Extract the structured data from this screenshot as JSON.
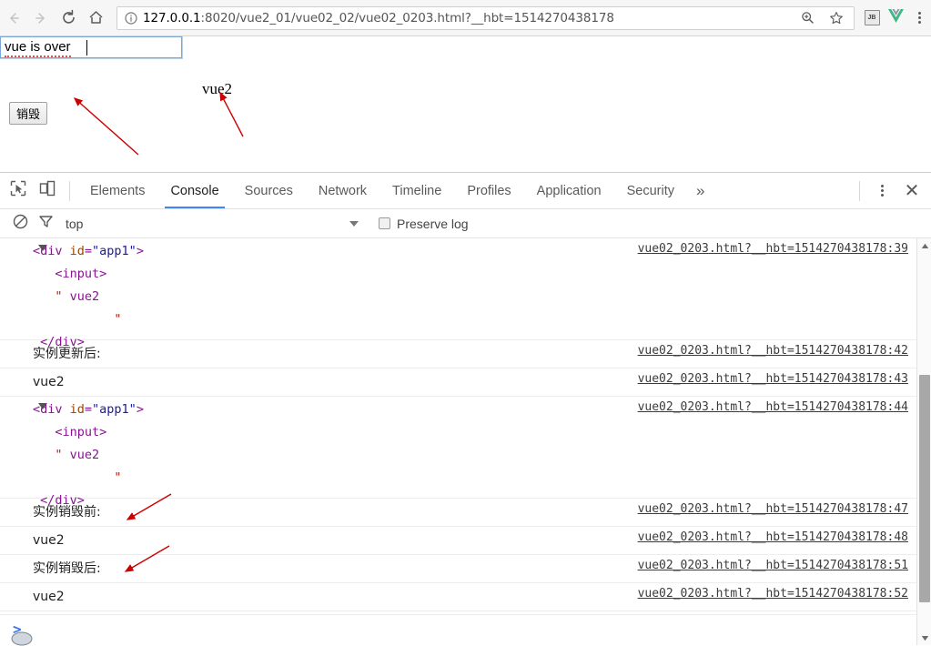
{
  "browser": {
    "nav": {
      "back_icon": "arrow-left-icon",
      "forward_icon": "arrow-right-icon",
      "reload_icon": "reload-icon",
      "home_icon": "home-icon"
    },
    "omnibox": {
      "info_icon": "page-info-icon",
      "url_host": "127.0.0.1",
      "url_rest": ":8020/vue2_01/vue02_02/vue02_0203.html?__hbt=1514270438178",
      "full_url": "127.0.0.1:8020/vue2_01/vue02_02/vue02_0203.html?__hbt=1514270438178",
      "zoom_icon": "zoom-magnifier-icon",
      "bookmark_icon": "star-icon"
    },
    "toolbar_right": {
      "extension_jb_label": "JB",
      "extension_jb_icon": "jetbrains-extension-icon",
      "extension_vue_icon": "vue-devtools-icon",
      "menu_icon": "kebab-menu-icon"
    }
  },
  "page": {
    "input": {
      "value": "vue is over",
      "placeholder": ""
    },
    "destroy_button_label": "销毁",
    "output_text": "vue2"
  },
  "devtools": {
    "inspect_icon": "inspect-element-icon",
    "device_toggle_icon": "device-toolbar-icon",
    "tabs": [
      {
        "label": "Elements",
        "active": false
      },
      {
        "label": "Console",
        "active": true
      },
      {
        "label": "Sources",
        "active": false
      },
      {
        "label": "Network",
        "active": false
      },
      {
        "label": "Timeline",
        "active": false
      },
      {
        "label": "Profiles",
        "active": false
      },
      {
        "label": "Application",
        "active": false
      },
      {
        "label": "Security",
        "active": false
      }
    ],
    "more_tabs_label": "»",
    "settings_icon": "kebab-menu-icon",
    "close_label": "✕",
    "console_filter": {
      "clear_icon": "clear-console-icon",
      "filter_icon": "filter-funnel-icon",
      "context_value": "top",
      "context_dropdown_icon": "chevron-down-icon",
      "preserve_log_label": "Preserve log",
      "preserve_log_checked": false
    },
    "messages": [
      {
        "type": "dom",
        "lines": [
          "<div id=\"app1\">",
          "  <input>",
          "  \" vue2",
          "        \"",
          "</div>"
        ],
        "source": "vue02_0203.html?__hbt=1514270438178:39"
      },
      {
        "type": "text",
        "text": "实例更新后:",
        "source": "vue02_0203.html?__hbt=1514270438178:42"
      },
      {
        "type": "text",
        "text": "vue2",
        "source": "vue02_0203.html?__hbt=1514270438178:43"
      },
      {
        "type": "dom",
        "lines": [
          "<div id=\"app1\">",
          "  <input>",
          "  \" vue2",
          "        \"",
          "</div>"
        ],
        "source": "vue02_0203.html?__hbt=1514270438178:44"
      },
      {
        "type": "text",
        "text": "实例销毁前:",
        "source": "vue02_0203.html?__hbt=1514270438178:47"
      },
      {
        "type": "text",
        "text": "vue2",
        "source": "vue02_0203.html?__hbt=1514270438178:48"
      },
      {
        "type": "text",
        "text": "实例销毁后:",
        "source": "vue02_0203.html?__hbt=1514270438178:51"
      },
      {
        "type": "text",
        "text": "vue2",
        "source": "vue02_0203.html?__hbt=1514270438178:52"
      }
    ],
    "prompt_symbol": ">"
  },
  "annotations": {
    "color": "#cc0000",
    "arrow_count": 4,
    "targets": [
      "input-field",
      "vue2-output",
      "实例销毁前:",
      "实例销毁后:"
    ]
  },
  "colors": {
    "accent_tab": "#4285f4",
    "annotation_red": "#cc0000",
    "dom_tag": "#881391",
    "dom_attr": "#994500",
    "dom_value": "#1a1aa6",
    "dom_string": "#c41a16",
    "vue_green": "#41b883"
  }
}
